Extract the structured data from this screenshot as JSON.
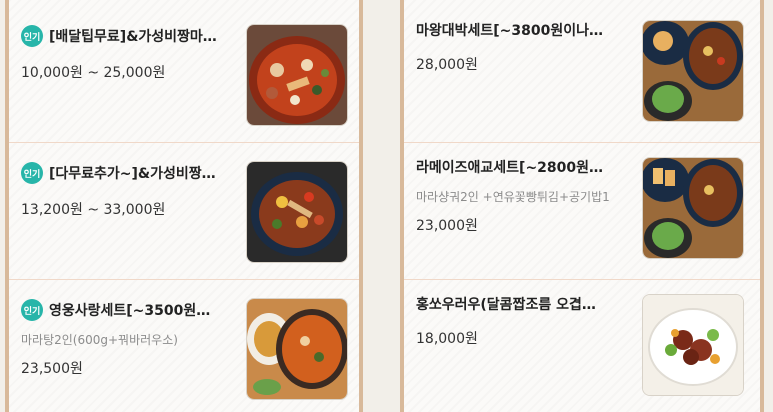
{
  "left_menu": [
    {
      "badge": "인기",
      "name": "[배달팁무료]&가성비짱마…",
      "desc": "",
      "price": "10,000원 ~ 25,000원",
      "photo": "spicy-hotpot-photo"
    },
    {
      "badge": "인기",
      "name": "[다무료추가~]&가성비짱…",
      "desc": "",
      "price": "13,200원 ~ 33,000원",
      "photo": "stir-fry-photo"
    },
    {
      "badge": "인기",
      "name": "영웅사랑세트[~3500원…",
      "desc": "마라탕2인(600g+꿔바러우소)",
      "price": "23,500원",
      "photo": "set-meal-photo"
    }
  ],
  "right_menu": [
    {
      "badge": "",
      "name": "마왕대박세트[~3800원이나…",
      "desc": "",
      "price": "28,000원",
      "photo": "combo-set-photo"
    },
    {
      "badge": "",
      "name": "라메이즈애교세트[~2800원…",
      "desc": "마라샹궈2인 +연유꽃빵튀김+공기밥1",
      "price": "23,000원",
      "photo": "combo-set-photo-2"
    },
    {
      "badge": "",
      "name": "홍쏘우러우(달콤짭조름 오겹…",
      "desc": "",
      "price": "18,000원",
      "photo": "braised-pork-photo"
    }
  ]
}
